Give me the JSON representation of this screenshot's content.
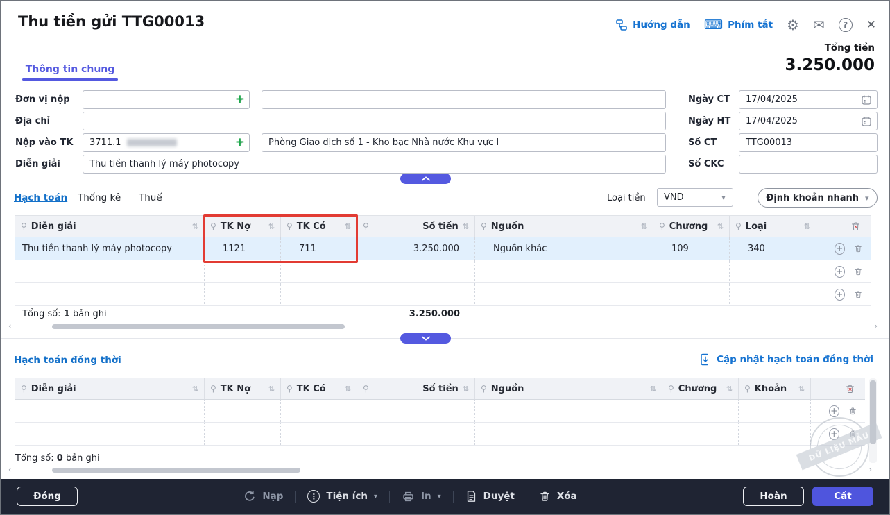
{
  "window": {
    "title": "Thu tiền gửi TTG00013"
  },
  "header": {
    "guide": "Hướng dẫn",
    "shortcuts": "Phím tắt",
    "total_label": "Tổng tiền",
    "total_value": "3.250.000",
    "tab": "Thông tin chung"
  },
  "form": {
    "don_vi_nop_label": "Đơn vị nộp",
    "don_vi_nop_code": "",
    "don_vi_nop_name": "",
    "dia_chi_label": "Địa chỉ",
    "dia_chi_value": "",
    "nop_vao_tk_label": "Nộp vào TK",
    "nop_vao_tk_code": "3711.1",
    "nop_vao_tk_name": "Phòng Giao dịch số 1 - Kho bạc Nhà nước Khu vực I",
    "dien_giai_label": "Diễn giải",
    "dien_giai_value": "Thu tiền thanh lý máy photocopy",
    "ngay_ct_label": "Ngày CT",
    "ngay_ct_value": "17/04/2025",
    "ngay_ht_label": "Ngày HT",
    "ngay_ht_value": "17/04/2025",
    "so_ct_label": "Số CT",
    "so_ct_value": "TTG00013",
    "so_ckc_label": "Số CKC",
    "so_ckc_value": ""
  },
  "accounting": {
    "tabs": [
      "Hạch toán",
      "Thống kê",
      "Thuế"
    ],
    "currency_label": "Loại tiền",
    "currency_value": "VND",
    "quick_entry_button": "Định khoản nhanh",
    "columns": [
      "Diễn giải",
      "TK Nợ",
      "TK Có",
      "Số tiền",
      "Nguồn",
      "Chương",
      "Loại"
    ],
    "row": {
      "dien_giai": "Thu tiền thanh lý máy photocopy",
      "tk_no": "1121",
      "tk_co": "711",
      "so_tien": "3.250.000",
      "nguon": "Nguồn khác",
      "chuong": "109",
      "loai": "340"
    },
    "summary_prefix": "Tổng số:",
    "summary_count": "1",
    "summary_suffix": "bản ghi",
    "summary_total": "3.250.000"
  },
  "simultaneous": {
    "title": "Hạch toán đồng thời",
    "update_link": "Cập nhật hạch toán đồng thời",
    "columns": [
      "Diễn giải",
      "TK Nợ",
      "TK Có",
      "Số tiền",
      "Nguồn",
      "Chương",
      "Khoản"
    ],
    "summary_prefix": "Tổng số:",
    "summary_count": "0",
    "summary_suffix": "bản ghi"
  },
  "watermark": "DỮ LIỆU MẪU",
  "footer": {
    "close": "Đóng",
    "reload": "Nạp",
    "utilities": "Tiện ích",
    "print": "In",
    "approve": "Duyệt",
    "delete": "Xóa",
    "undo": "Hoàn",
    "save": "Cất"
  },
  "icons": {
    "pin": "⚲",
    "sort": "⇅",
    "caret": "▾",
    "plus": "+",
    "question": "?",
    "close": "✕",
    "dots": "⋮",
    "gear": "⚙",
    "mail": "✉",
    "keyboard": "⌨",
    "scroll_left": "‹",
    "scroll_right": "›"
  },
  "colors": {
    "accent": "#5459e0",
    "link": "#1673d1",
    "annotation": "#e23b33",
    "footer_bg": "#1f2433",
    "selected_row": "#e2f0fd"
  }
}
